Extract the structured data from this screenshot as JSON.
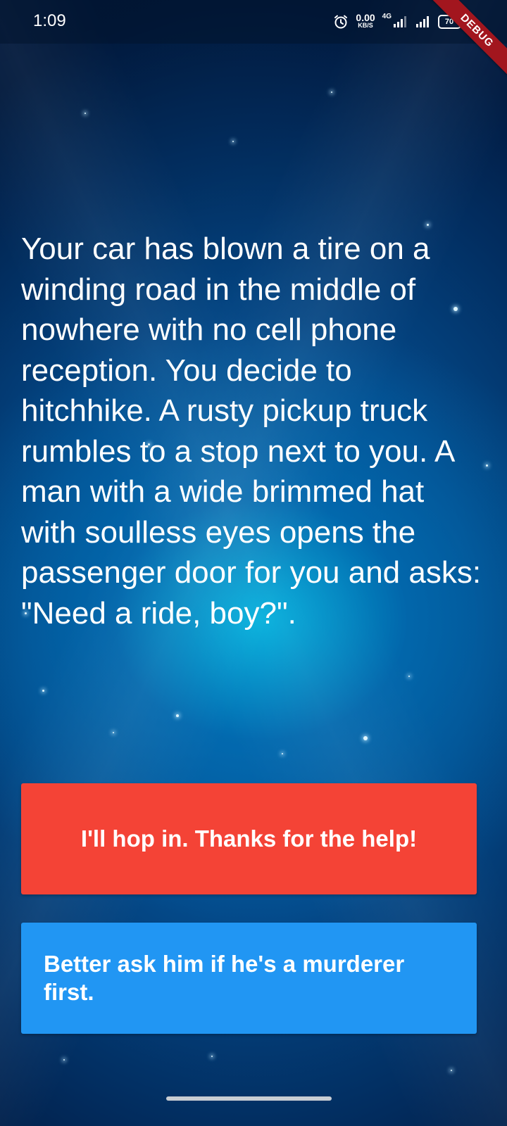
{
  "status_bar": {
    "time": "1:09",
    "net_speed_value": "0.00",
    "net_speed_unit": "KB/S",
    "network_type": "4G",
    "battery_level": "70"
  },
  "debug_banner": {
    "label": "DEBUG",
    "color": "#a2161e"
  },
  "story": {
    "text": "Your car has blown a tire on a winding road in the middle of nowhere with no cell phone reception. You decide to hitchhike. A rusty pickup truck rumbles to a stop next to you. A man with a wide brimmed hat with soulless eyes opens the passenger door for you and asks: \"Need a ride, boy?\"."
  },
  "choices": [
    {
      "label": "I'll hop in. Thanks for the help!",
      "color": "#f44336"
    },
    {
      "label": "Better ask him if he's a murderer first.",
      "color": "#2196f3"
    }
  ],
  "icons": {
    "alarm": "alarm-clock-icon",
    "signal_1": "cell-signal-icon",
    "signal_2": "cell-signal-icon",
    "battery": "battery-icon"
  }
}
